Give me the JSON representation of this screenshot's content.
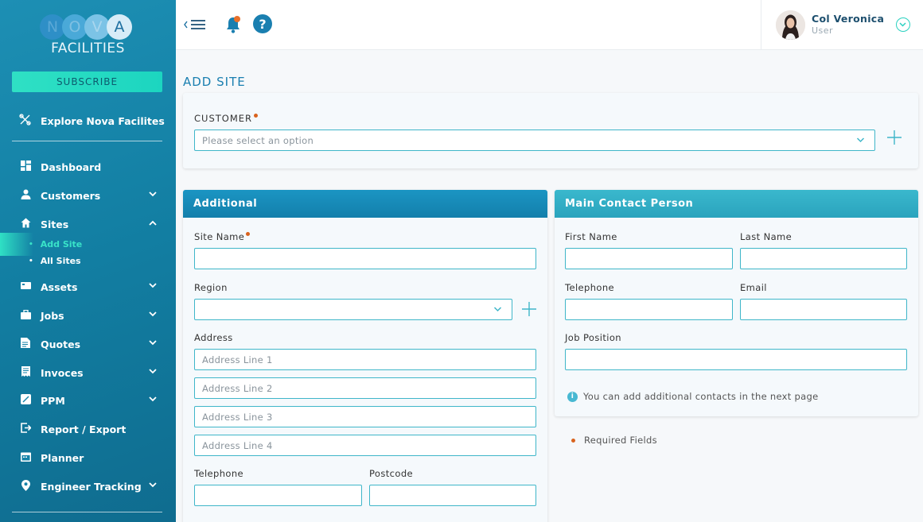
{
  "brand": {
    "logo_letters": [
      "N",
      "O",
      "V",
      "A"
    ],
    "logo_sub": "FACILITIES",
    "accent": "#2fe0c4",
    "primary": "#1a7fb0"
  },
  "sidebar": {
    "subscribe_label": "SUBSCRIBE",
    "explore_label": "Explore Nova Facilites",
    "items": [
      {
        "label": "Dashboard",
        "icon": "dashboard-icon"
      },
      {
        "label": "Customers",
        "icon": "user-icon"
      },
      {
        "label": "Sites",
        "icon": "home-icon"
      },
      {
        "label": "Assets",
        "icon": "asset-icon"
      },
      {
        "label": "Jobs",
        "icon": "briefcase-icon"
      },
      {
        "label": "Quotes",
        "icon": "document-icon"
      },
      {
        "label": "Invoces",
        "icon": "invoice-icon"
      },
      {
        "label": "PPM",
        "icon": "ppm-icon"
      },
      {
        "label": "Report / Export",
        "icon": "export-icon"
      },
      {
        "label": "Planner",
        "icon": "calendar-icon"
      },
      {
        "label": "Engineer Tracking",
        "icon": "location-pin-icon"
      }
    ],
    "sites_sub": [
      "Add Site",
      "All Sites"
    ]
  },
  "header": {
    "user_name": "Col Veronica",
    "user_role": "User"
  },
  "page": {
    "title": "ADD SITE",
    "customer_label": "CUSTOMER",
    "customer_placeholder": "Please select an option"
  },
  "additional": {
    "title": "Additional",
    "site_name_label": "Site Name",
    "site_name_value": "",
    "region_label": "Region",
    "region_value": "",
    "address_label": "Address",
    "address_placeholders": [
      "Address Line 1",
      "Address Line 2",
      "Address Line 3",
      "Address Line 4"
    ],
    "telephone_label": "Telephone",
    "postcode_label": "Postcode"
  },
  "contact": {
    "title": "Main Contact Person",
    "first_name_label": "First Name",
    "last_name_label": "Last Name",
    "telephone_label": "Telephone",
    "email_label": "Email",
    "job_position_label": "Job Position",
    "info_text": "You can add additional contacts in the next page"
  },
  "footer_note": "Required Fields"
}
